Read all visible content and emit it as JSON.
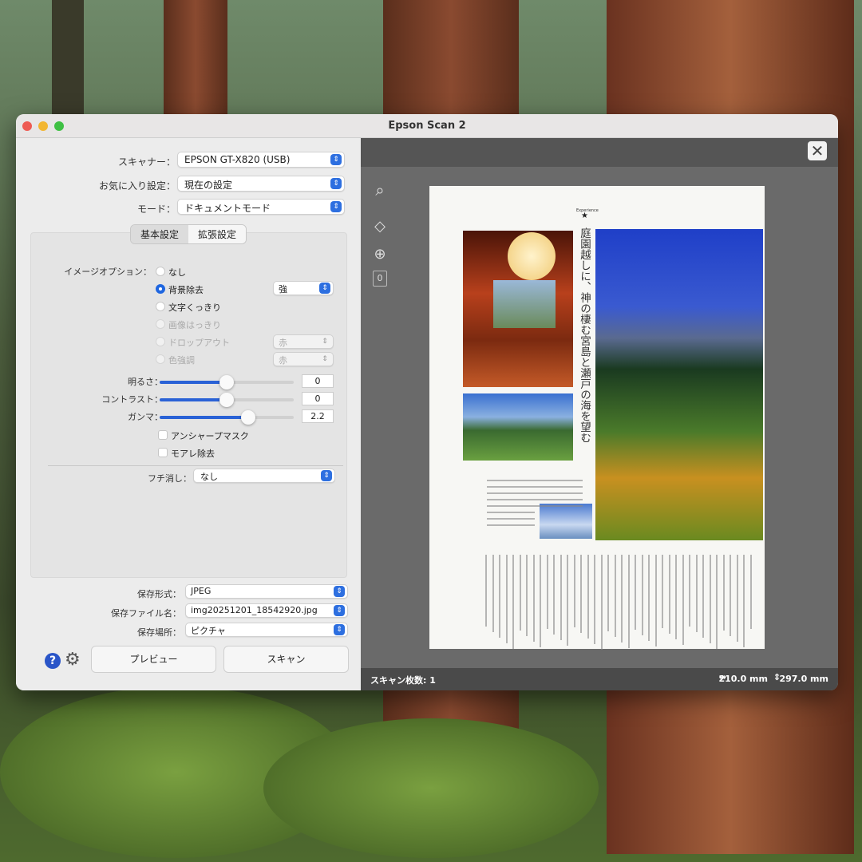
{
  "window": {
    "title": "Epson Scan 2"
  },
  "settings": {
    "scanner": {
      "label": "スキャナー：",
      "value": "EPSON GT-X820 (USB)"
    },
    "favorite": {
      "label": "お気に入り設定：",
      "value": "現在の設定"
    },
    "mode": {
      "label": "モード：",
      "value": "ドキュメントモード"
    },
    "tabs": [
      {
        "label": "基本設定"
      },
      {
        "label": "拡張設定"
      }
    ],
    "image_option": {
      "label": "イメージオプション：",
      "options": [
        "なし",
        "背景除去",
        "文字くっきり",
        "画像はっきり",
        "ドロップアウト",
        "色強調"
      ],
      "selected": "背景除去",
      "strength": "強",
      "dropout_color": "赤",
      "enhance_color": "赤"
    },
    "brightness": {
      "label": "明るさ：",
      "value": "0",
      "level": 0.5
    },
    "contrast": {
      "label": "コントラスト：",
      "value": "0",
      "level": 0.5
    },
    "gamma": {
      "label": "ガンマ：",
      "value": "2.2",
      "level": 0.66
    },
    "unsharp_mask": {
      "label": "アンシャープマスク",
      "checked": false
    },
    "descreening": {
      "label": "モアレ除去",
      "checked": false
    },
    "edge_fill": {
      "label": "フチ消し：",
      "value": "なし"
    },
    "format": {
      "label": "保存形式：",
      "value": "JPEG"
    },
    "filename": {
      "label": "保存ファイル名：",
      "value": "img20251201_18542920.jpg"
    },
    "folder": {
      "label": "保存場所：",
      "value": "ピクチャ"
    },
    "preview_button": "プレビュー",
    "scan_button": "スキャン"
  },
  "preview": {
    "page_count_badge": "0",
    "scan_count": "スキャン枚数: 1",
    "width": "210.0 mm",
    "height": "297.0 mm",
    "document": {
      "section": "Experience",
      "headline": "庭園越しに、神の棲む宮島と瀬戸の海を望む"
    }
  },
  "colors": {
    "accent": "#2d6fe0"
  }
}
